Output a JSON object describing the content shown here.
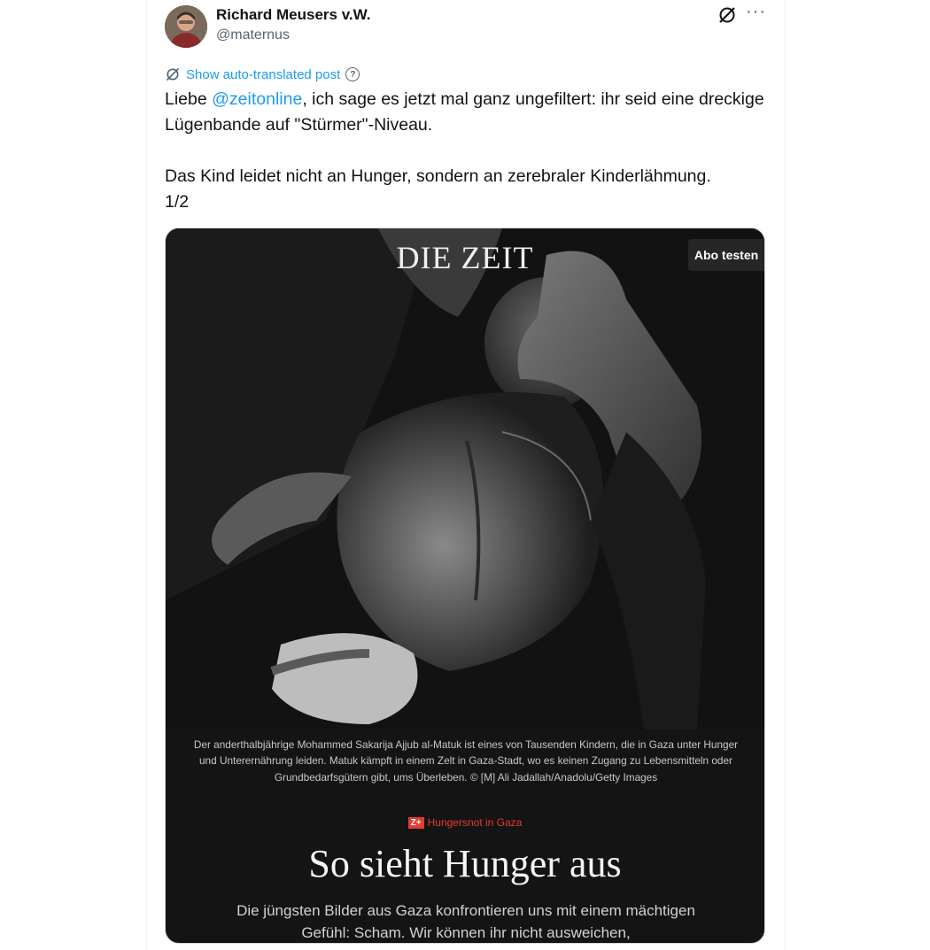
{
  "author": {
    "name": "Richard Meusers v.W.",
    "handle": "@maternus"
  },
  "header_icons": [
    "grok-icon",
    "more-icon"
  ],
  "more_label": "···",
  "translate": {
    "label": "Show auto-translated post",
    "help_label": "?"
  },
  "tweet": {
    "line1_prefix": "Liebe ",
    "mention": "@zeitonline",
    "line1_rest": ", ich sage es jetzt mal ganz ungefiltert: ihr seid eine dreckige Lügenbande auf \"Stürmer\"-Niveau.",
    "paragraph2": "Das Kind leidet nicht an Hunger, sondern an zerebraler Kinderlähmung.",
    "counter": "1/2"
  },
  "media": {
    "logo": "DIE ZEIT",
    "abo_button": "Abo testen",
    "caption": "Der anderthalbjährige Mohammed Sakarija Ajjub al-Matuk ist eines von Tausenden Kindern, die in Gaza unter Hunger und Unterernährung leiden. Matuk kämpft in einem Zelt in Gaza-Stadt, wo es keinen Zugang zu Lebensmitteln oder Grundbedarfsgütern gibt, ums Überleben. © [M] Ali Jadallah/Anadolu/Getty Images",
    "kicker_badge": "Z+",
    "kicker": "Hungersnot in Gaza",
    "headline": "So sieht Hunger aus",
    "teaser": "Die jüngsten Bilder aus Gaza konfrontieren uns mit einem mächtigen Gefühl: Scham. Wir können ihr nicht ausweichen,"
  },
  "colors": {
    "link": "#1d9bf0",
    "text": "#0f1419",
    "secondary": "#536471",
    "zeit_red": "#e63a32",
    "media_bg": "#141414"
  }
}
